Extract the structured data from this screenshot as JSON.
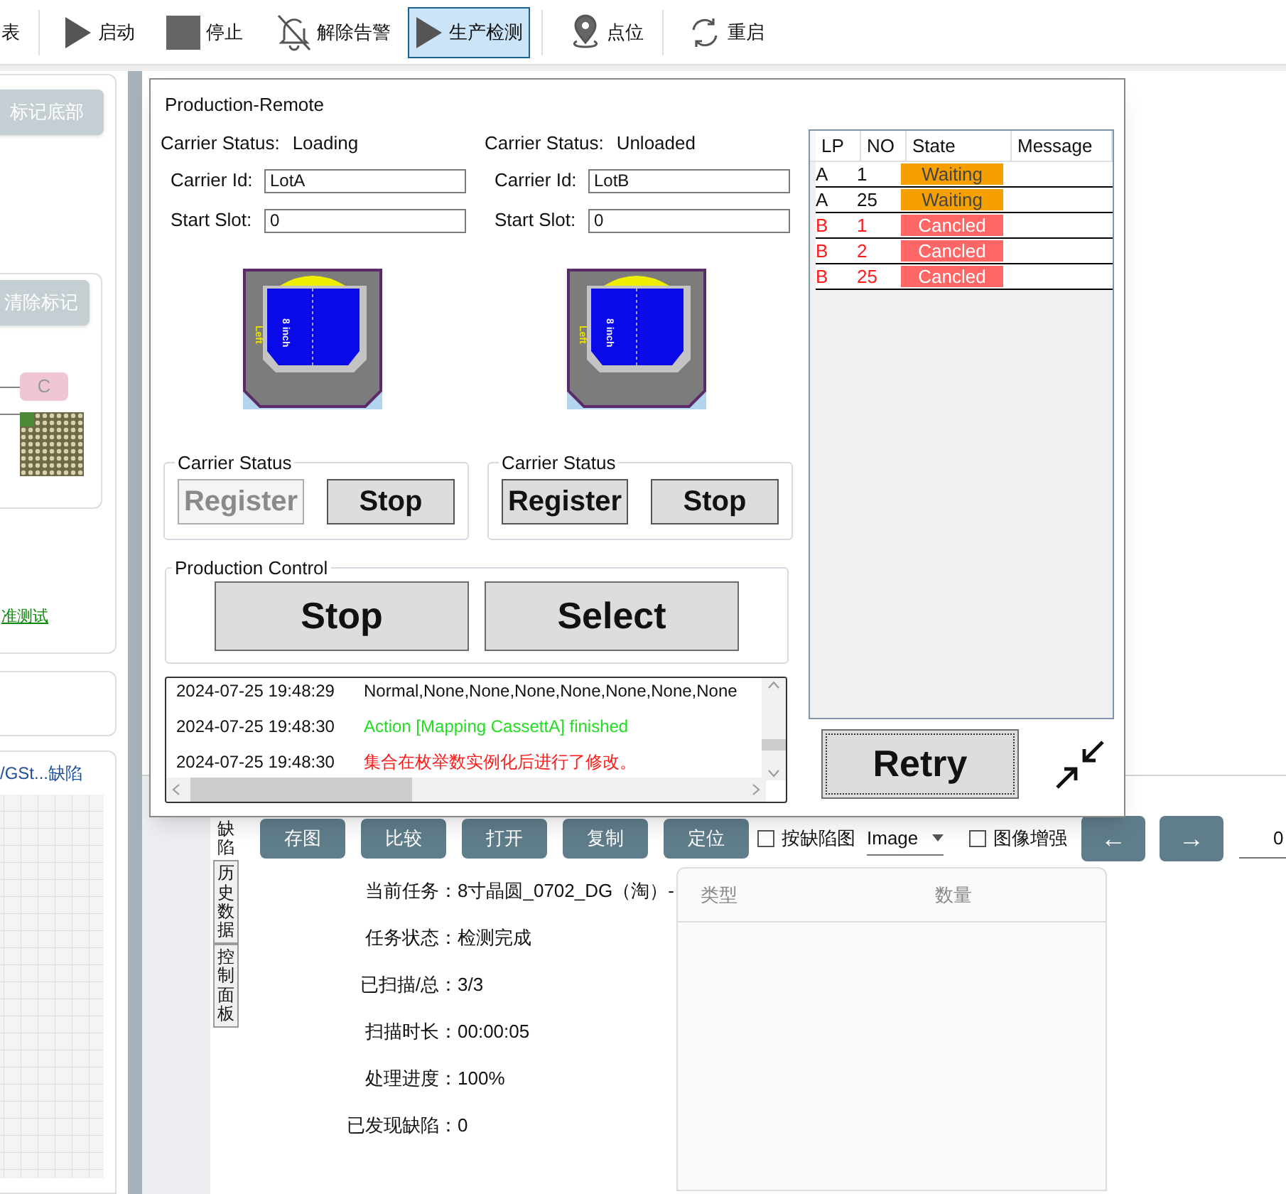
{
  "toolbar": {
    "items": [
      {
        "label": "表",
        "kind": "text",
        "selected": false
      },
      {
        "label": "启动",
        "kind": "play",
        "selected": false
      },
      {
        "label": "停止",
        "kind": "stop",
        "selected": false
      },
      {
        "label": "解除告警",
        "kind": "mute",
        "selected": false
      },
      {
        "label": "生产检测",
        "kind": "play",
        "selected": true
      },
      {
        "label": "点位",
        "kind": "pin",
        "selected": false
      },
      {
        "label": "重启",
        "kind": "refresh",
        "selected": false
      }
    ]
  },
  "left_panel": {
    "mark_bottom_button": "标记底部",
    "clear_marks_button": "清除标记",
    "badge": "C",
    "link": "准测试",
    "item_text": "/GSt...缺陷"
  },
  "dialog": {
    "title": "Production-Remote",
    "carriers": [
      {
        "status_label": "Carrier Status:",
        "status": "Loading",
        "id_label": "Carrier Id:",
        "id": "LotA",
        "slot_label": "Start Slot:",
        "slot": "0",
        "size_label": "8 inch",
        "side_label": "Left",
        "group_title": "Carrier Status",
        "register": {
          "label": "Register",
          "disabled": true
        },
        "stop": "Stop"
      },
      {
        "status_label": "Carrier Status:",
        "status": "Unloaded",
        "id_label": "Carrier Id:",
        "id": "LotB",
        "slot_label": "Start Slot:",
        "slot": "0",
        "size_label": "8 inch",
        "side_label": "Left",
        "group_title": "Carrier Status",
        "register": {
          "label": "Register",
          "disabled": false
        },
        "stop": "Stop"
      }
    ],
    "production_control": {
      "title": "Production Control",
      "buttons": [
        "Stop",
        "Select"
      ]
    },
    "log": [
      {
        "time": "2024-07-25 19:48:29",
        "message": "Normal,None,None,None,None,None,None,None",
        "kind": "info"
      },
      {
        "time": "2024-07-25 19:48:30",
        "message": "Action [Mapping CassettA] finished",
        "kind": "success"
      },
      {
        "time": "2024-07-25 19:48:30",
        "message": "集合在枚举数实例化后进行了修改。",
        "kind": "error"
      }
    ],
    "queue": {
      "columns": [
        "LP",
        "NO",
        "State",
        "Message"
      ],
      "rows": [
        {
          "lp": "A",
          "no": "1",
          "state": "Waiting",
          "kind": "waiting"
        },
        {
          "lp": "A",
          "no": "25",
          "state": "Waiting",
          "kind": "waiting"
        },
        {
          "lp": "B",
          "no": "1",
          "state": "Cancled",
          "kind": "cancelled"
        },
        {
          "lp": "B",
          "no": "2",
          "state": "Cancled",
          "kind": "cancelled"
        },
        {
          "lp": "B",
          "no": "25",
          "state": "Cancled",
          "kind": "cancelled"
        }
      ]
    },
    "retry": "Retry"
  },
  "bottom": {
    "vertical_tabs": [
      {
        "label": "缺陷",
        "selected": true
      },
      {
        "label": "历史数据",
        "selected": false
      },
      {
        "label": "控制面板",
        "selected": false
      }
    ],
    "tools": {
      "buttons": [
        "存图",
        "比较",
        "打开",
        "复制",
        "定位"
      ],
      "checkboxes": [
        {
          "label": "按缺陷图",
          "checked": false
        },
        {
          "label": "图像增强",
          "checked": false
        }
      ],
      "dropdown": "Image",
      "prev": "←",
      "next": "→",
      "field": "0"
    },
    "info": [
      {
        "label": "当前任务：",
        "value": "8寸晶圆_0702_DG（淘）-"
      },
      {
        "label": "任务状态：",
        "value": "检测完成"
      },
      {
        "label": "已扫描/总：",
        "value": "3/3"
      },
      {
        "label": "扫描时长：",
        "value": "00:00:05"
      },
      {
        "label": "处理进度：",
        "value": "100%"
      },
      {
        "label": "已发现缺陷：",
        "value": "0"
      }
    ],
    "stats_table": {
      "columns": [
        "类型",
        "数量"
      ]
    }
  }
}
